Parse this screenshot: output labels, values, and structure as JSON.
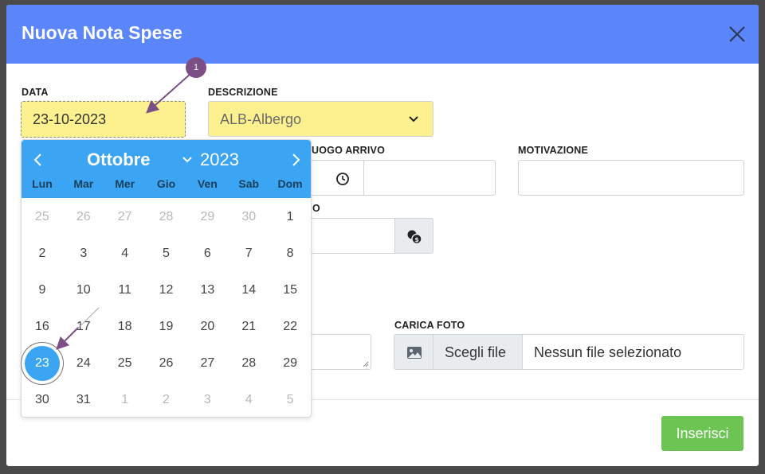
{
  "modal": {
    "title": "Nuova Nota Spese"
  },
  "form": {
    "data_label": "DATA",
    "data_value": "23-10-2023",
    "descrizione_label": "DESCRIZIONE",
    "descrizione_value": "ALB-Albergo",
    "luogo_arrivo_label": "UOGO ARRIVO",
    "motivazione_label": "MOTIVAZIONE",
    "importo_label_fragment": "O",
    "carica_foto_label": "CARICA FOTO",
    "choose_file_label": "Scegli file",
    "no_file_text": "Nessun file selezionato"
  },
  "footer": {
    "submit_label": "Inserisci"
  },
  "calendar": {
    "month": "Ottobre",
    "year": "2023",
    "weekdays": [
      "Lun",
      "Mar",
      "Mer",
      "Gio",
      "Ven",
      "Sab",
      "Dom"
    ],
    "weeks": [
      [
        "25",
        "26",
        "27",
        "28",
        "29",
        "30",
        "1"
      ],
      [
        "2",
        "3",
        "4",
        "5",
        "6",
        "7",
        "8"
      ],
      [
        "9",
        "10",
        "11",
        "12",
        "13",
        "14",
        "15"
      ],
      [
        "16",
        "17",
        "18",
        "19",
        "20",
        "21",
        "22"
      ],
      [
        "23",
        "24",
        "25",
        "26",
        "27",
        "28",
        "29"
      ],
      [
        "30",
        "31",
        "1",
        "2",
        "3",
        "4",
        "5"
      ]
    ],
    "selected": "23"
  },
  "annotation": {
    "badge": "1"
  },
  "colors": {
    "header": "#5b86fb",
    "calendar_header": "#3ba5f3",
    "highlight_field": "#fdf18f",
    "submit": "#6cc453",
    "annotation": "#7b4f86"
  },
  "icons": {
    "close": "close-icon",
    "chevron_down": "chevron-down-icon",
    "clock": "clock-icon",
    "coins": "coins-icon",
    "image": "image-icon",
    "prev": "chevron-left-icon",
    "next": "chevron-right-icon"
  }
}
